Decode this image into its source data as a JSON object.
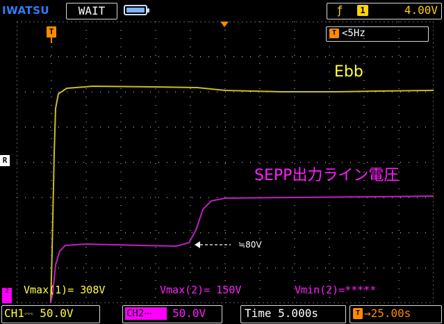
{
  "header": {
    "brand": "IWATSU",
    "run_state": "WAIT",
    "trigger_edge_icon": "rising-edge-icon",
    "trigger_channel": "1",
    "trigger_level": "4.00V"
  },
  "plot": {
    "position_marker": "T",
    "frequency_icon": "T",
    "frequency_text": "<5Hz",
    "reference_marker": "R",
    "ch2_marker": "2",
    "label_ebb": "Ebb",
    "label_sepp": "SEPP出力ライン電圧",
    "annotation": "≒80V",
    "colors": {
      "ch1": "#c8c020",
      "ch2": "#c020c0",
      "grid": "#bdbdbd"
    }
  },
  "measurements": {
    "vmax1": "Vmax(1)= 308V",
    "vmax2": "Vmax(2)= 150V",
    "vmin2": "Vmin(2)=*****"
  },
  "footer": {
    "ch1": "CH1⎓  50.0V",
    "ch2_tag": "CH2⎓",
    "ch2_value": "50.0V",
    "time": "Time 5.000s",
    "trigger_icon": "T",
    "trigger_position": "→25.00s"
  }
}
